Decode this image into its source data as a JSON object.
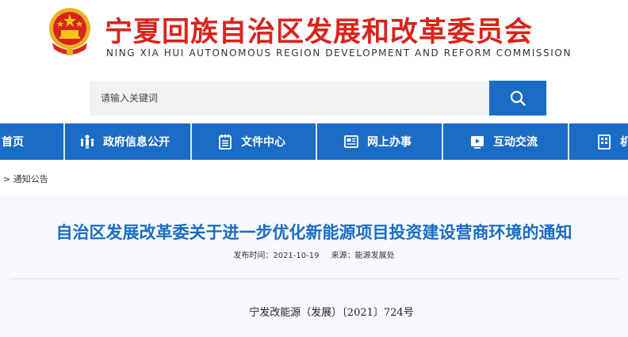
{
  "header": {
    "title_cn": "宁夏回族自治区发展和改革委员会",
    "title_en": "NING XIA HUI AUTONOMOUS REGION DEVELOPMENT AND REFORM COMMISSION",
    "brand_color": "#d9241c",
    "emblem_icon": "national-emblem-icon"
  },
  "search": {
    "placeholder": "请输入关键词",
    "button_icon": "search-icon",
    "button_color": "#1a6cc4"
  },
  "nav": {
    "color": "#1a6cc4",
    "items": [
      {
        "label": "首页",
        "icon": ""
      },
      {
        "label": "政府信息公开",
        "icon": "people-icon"
      },
      {
        "label": "文件中心",
        "icon": "document-icon"
      },
      {
        "label": "网上办事",
        "icon": "newspaper-icon"
      },
      {
        "label": "互动交流",
        "icon": "play-icon"
      },
      {
        "label": "机",
        "icon": "building-icon"
      }
    ]
  },
  "breadcrumb": {
    "separator": ">",
    "current": "通知公告"
  },
  "article": {
    "title": "自治区发展改革委关于进一步优化新能源项目投资建设营商环境的通知",
    "publish_time": "发布时间：2021-10-19",
    "source": "来源：能源发展处",
    "doc_number": "宁发改能源（发展）〔2021〕724号"
  }
}
